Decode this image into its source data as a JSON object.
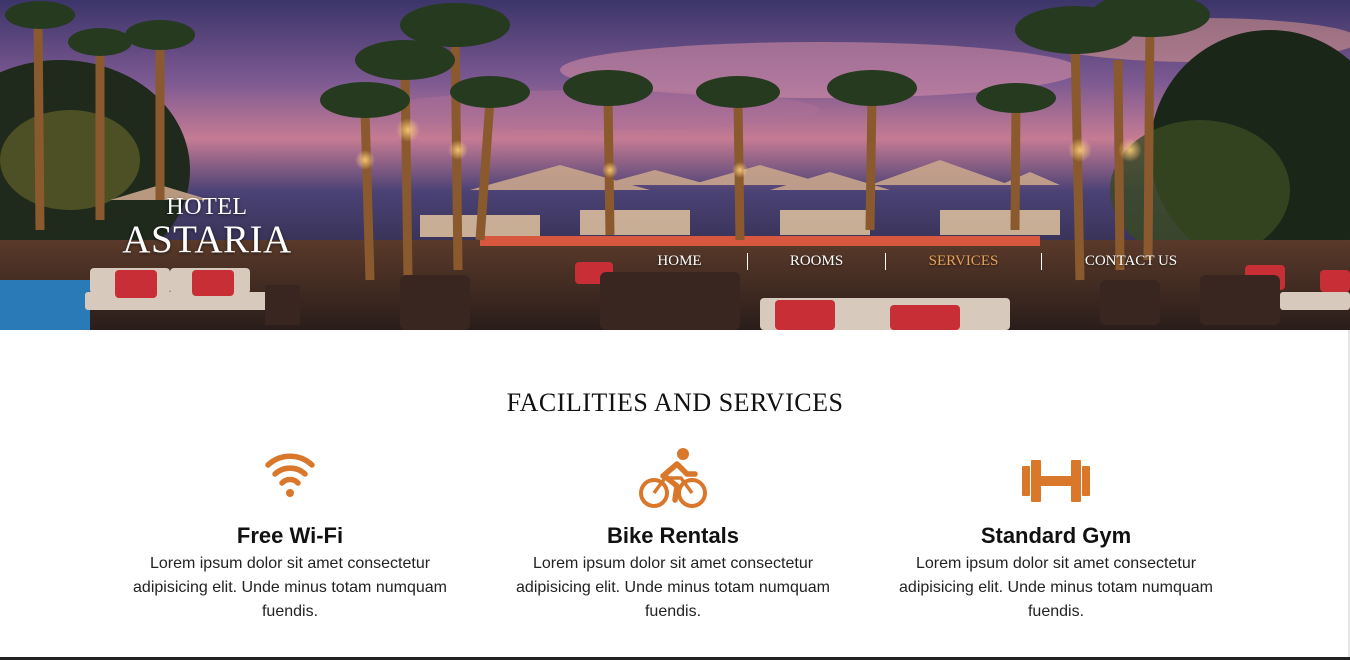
{
  "brand": {
    "line1": "HOTEL",
    "line2": "ASTARIA"
  },
  "nav": {
    "items": [
      {
        "label": "HOME",
        "active": false
      },
      {
        "label": "ROOMS",
        "active": false
      },
      {
        "label": "SERVICES",
        "active": true
      },
      {
        "label": "CONTACT US",
        "active": false
      }
    ],
    "active_color": "#e9a15a"
  },
  "section": {
    "title": "FACILITIES AND SERVICES"
  },
  "services": [
    {
      "icon": "wifi-icon",
      "title": "Free Wi-Fi",
      "text": "Lorem ipsum dolor sit amet consectetur adipisicing elit. Unde minus totam numquam fuendis."
    },
    {
      "icon": "bicycle-icon",
      "title": "Bike Rentals",
      "text": "Lorem ipsum dolor sit amet consectetur adipisicing elit. Unde minus totam numquam fuendis."
    },
    {
      "icon": "dumbbell-icon",
      "title": "Standard Gym",
      "text": "Lorem ipsum dolor sit amet consectetur adipisicing elit. Unde minus totam numquam fuendis."
    }
  ],
  "colors": {
    "accent": "#d9772b",
    "text": "#111111"
  }
}
